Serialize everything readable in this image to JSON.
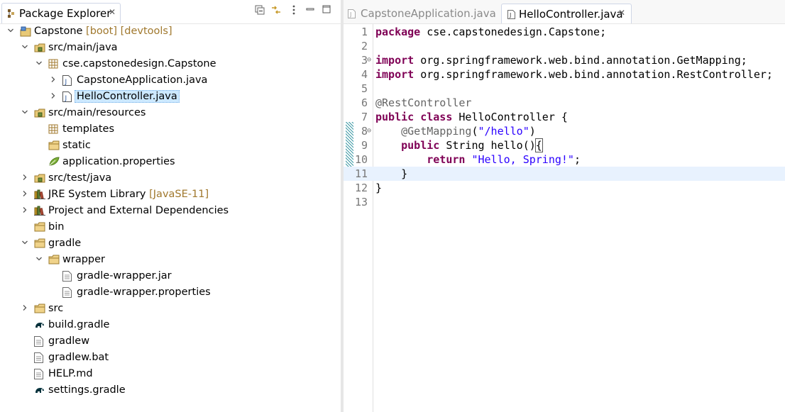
{
  "explorer": {
    "title": "Package Explorer",
    "close_glyph": "✕",
    "toolbar_icons": [
      "collapse-all-icon",
      "link-with-editor-icon",
      "view-menu-icon",
      "minimize-icon",
      "maximize-icon"
    ]
  },
  "tree": [
    {
      "label": "Capstone",
      "deco": "[boot] [devtools]",
      "icon": "project-icon",
      "depth": 0,
      "arrow": "open"
    },
    {
      "label": "src/main/java",
      "icon": "source-folder-icon",
      "depth": 1,
      "arrow": "open"
    },
    {
      "label": "cse.capstonedesign.Capstone",
      "icon": "package-icon",
      "depth": 2,
      "arrow": "open"
    },
    {
      "label": "CapstoneApplication.java",
      "icon": "java-file-icon",
      "depth": 3,
      "arrow": "closed"
    },
    {
      "label": "HelloController.java",
      "icon": "java-file-icon",
      "depth": 3,
      "arrow": "closed",
      "selected": true
    },
    {
      "label": "src/main/resources",
      "icon": "source-folder-icon",
      "depth": 1,
      "arrow": "open"
    },
    {
      "label": "templates",
      "icon": "package-icon",
      "depth": 2,
      "arrow": "none"
    },
    {
      "label": "static",
      "icon": "folder-icon",
      "depth": 2,
      "arrow": "none"
    },
    {
      "label": "application.properties",
      "icon": "properties-leaf-icon",
      "depth": 2,
      "arrow": "none"
    },
    {
      "label": "src/test/java",
      "icon": "source-folder-icon",
      "depth": 1,
      "arrow": "closed"
    },
    {
      "label": "JRE System Library",
      "deco": "[JavaSE-11]",
      "icon": "library-icon",
      "depth": 1,
      "arrow": "closed"
    },
    {
      "label": "Project and External Dependencies",
      "icon": "library-icon",
      "depth": 1,
      "arrow": "closed"
    },
    {
      "label": "bin",
      "icon": "folder-icon",
      "depth": 1,
      "arrow": "none"
    },
    {
      "label": "gradle",
      "icon": "folder-icon",
      "depth": 1,
      "arrow": "open"
    },
    {
      "label": "wrapper",
      "icon": "folder-icon",
      "depth": 2,
      "arrow": "open"
    },
    {
      "label": "gradle-wrapper.jar",
      "icon": "file-icon",
      "depth": 3,
      "arrow": "none"
    },
    {
      "label": "gradle-wrapper.properties",
      "icon": "file-icon",
      "depth": 3,
      "arrow": "none"
    },
    {
      "label": "src",
      "icon": "folder-icon",
      "depth": 1,
      "arrow": "closed"
    },
    {
      "label": "build.gradle",
      "icon": "gradle-elephant-icon",
      "depth": 1,
      "arrow": "none"
    },
    {
      "label": "gradlew",
      "icon": "file-icon",
      "depth": 1,
      "arrow": "none"
    },
    {
      "label": "gradlew.bat",
      "icon": "file-icon",
      "depth": 1,
      "arrow": "none"
    },
    {
      "label": "HELP.md",
      "icon": "file-icon",
      "depth": 1,
      "arrow": "none"
    },
    {
      "label": "settings.gradle",
      "icon": "gradle-elephant-icon",
      "depth": 1,
      "arrow": "none"
    }
  ],
  "editor": {
    "tabs": [
      {
        "label": "CapstoneApplication.java",
        "active": false
      },
      {
        "label": "HelloController.java",
        "active": true,
        "close_glyph": "✕"
      }
    ],
    "lines": [
      {
        "n": "1",
        "segs": [
          {
            "t": "package",
            "c": "kw"
          },
          {
            "t": " cse.capstonedesign.Capstone;",
            "c": ""
          }
        ]
      },
      {
        "n": "2",
        "segs": []
      },
      {
        "n": "3",
        "fold": "⊖",
        "segs": [
          {
            "t": "import",
            "c": "kw"
          },
          {
            "t": " org.springframework.web.bind.annotation.GetMapping;",
            "c": ""
          }
        ]
      },
      {
        "n": "4",
        "segs": [
          {
            "t": "import",
            "c": "kw"
          },
          {
            "t": " org.springframework.web.bind.annotation.RestController;",
            "c": ""
          }
        ]
      },
      {
        "n": "5",
        "segs": []
      },
      {
        "n": "6",
        "segs": [
          {
            "t": "@RestController",
            "c": "ann"
          }
        ]
      },
      {
        "n": "7",
        "segs": [
          {
            "t": "public",
            "c": "kw"
          },
          {
            "t": " ",
            "c": ""
          },
          {
            "t": "class",
            "c": "kw"
          },
          {
            "t": " HelloController {",
            "c": ""
          }
        ]
      },
      {
        "n": "8",
        "fold": "⊖",
        "segs": [
          {
            "t": "    ",
            "c": ""
          },
          {
            "t": "@GetMapping",
            "c": "ann"
          },
          {
            "t": "(",
            "c": ""
          },
          {
            "t": "\"/hello\"",
            "c": "str"
          },
          {
            "t": ")",
            "c": ""
          }
        ]
      },
      {
        "n": "9",
        "segs": [
          {
            "t": "    ",
            "c": ""
          },
          {
            "t": "public",
            "c": "kw"
          },
          {
            "t": " String hello()",
            "c": ""
          },
          {
            "t": "{",
            "c": "brk"
          }
        ]
      },
      {
        "n": "10",
        "segs": [
          {
            "t": "        ",
            "c": ""
          },
          {
            "t": "return",
            "c": "kw"
          },
          {
            "t": " ",
            "c": ""
          },
          {
            "t": "\"Hello, Spring!\"",
            "c": "str"
          },
          {
            "t": ";",
            "c": ""
          }
        ]
      },
      {
        "n": "11",
        "current": true,
        "segs": [
          {
            "t": "    }",
            "c": ""
          }
        ]
      },
      {
        "n": "12",
        "segs": [
          {
            "t": "}",
            "c": ""
          }
        ]
      },
      {
        "n": "13",
        "segs": []
      }
    ]
  },
  "colors": {
    "keyword": "#7f0055",
    "string": "#2a00ff",
    "annotation": "#646464",
    "selection": "#cce8ff",
    "current_line": "#e8f2fe"
  }
}
